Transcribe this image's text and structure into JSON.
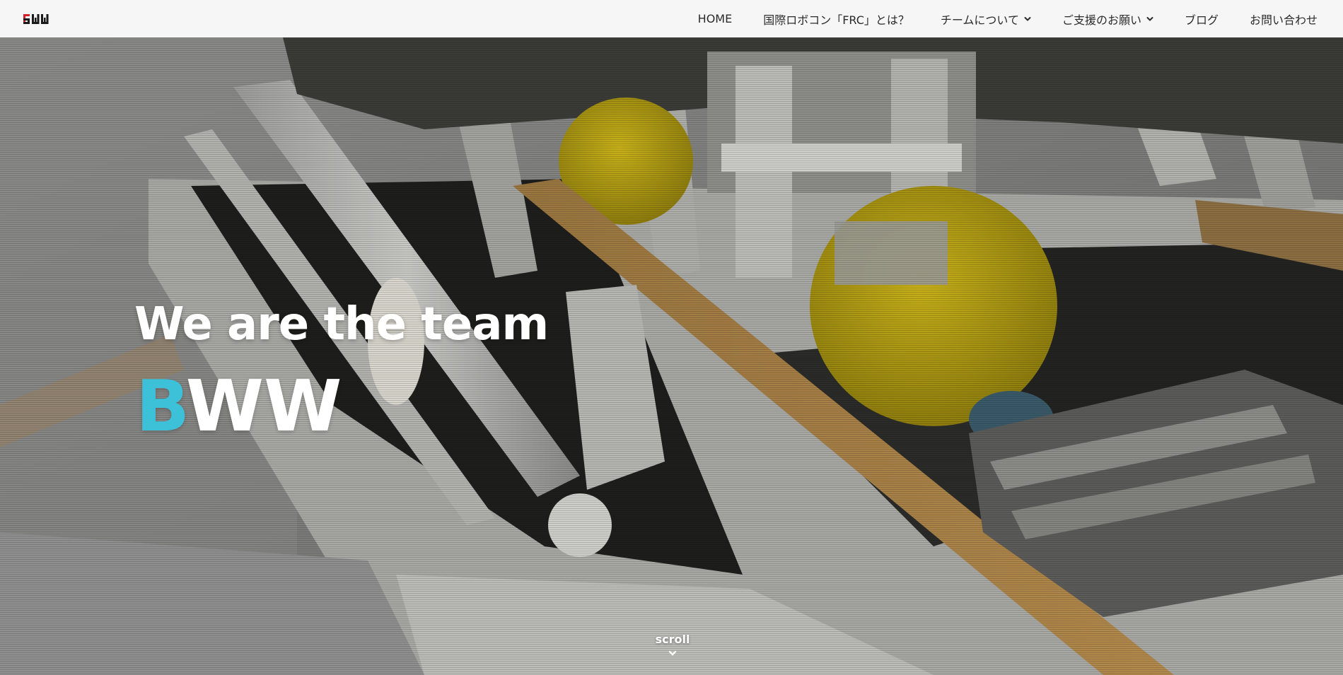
{
  "header": {
    "logo_text": "BWW",
    "nav": [
      {
        "label": "HOME",
        "has_dropdown": false
      },
      {
        "label": "国際ロボコン「FRC」とは？",
        "has_dropdown": false
      },
      {
        "label": "チームについて",
        "has_dropdown": true
      },
      {
        "label": "ご支援のお願い",
        "has_dropdown": true
      },
      {
        "label": "ブログ",
        "has_dropdown": false
      },
      {
        "label": "お問い合わせ",
        "has_dropdown": false
      }
    ]
  },
  "hero": {
    "tagline": "We are the team",
    "team_accent_letter": "B",
    "team_rest": "WW",
    "scroll_label": "scroll",
    "scroll_icon": "chevron-down-icon"
  },
  "colors": {
    "accent": "#3dc1d8",
    "header_bg": "#f6f6f6",
    "nav_text": "#2b2b2b",
    "hero_text": "#ffffff"
  }
}
